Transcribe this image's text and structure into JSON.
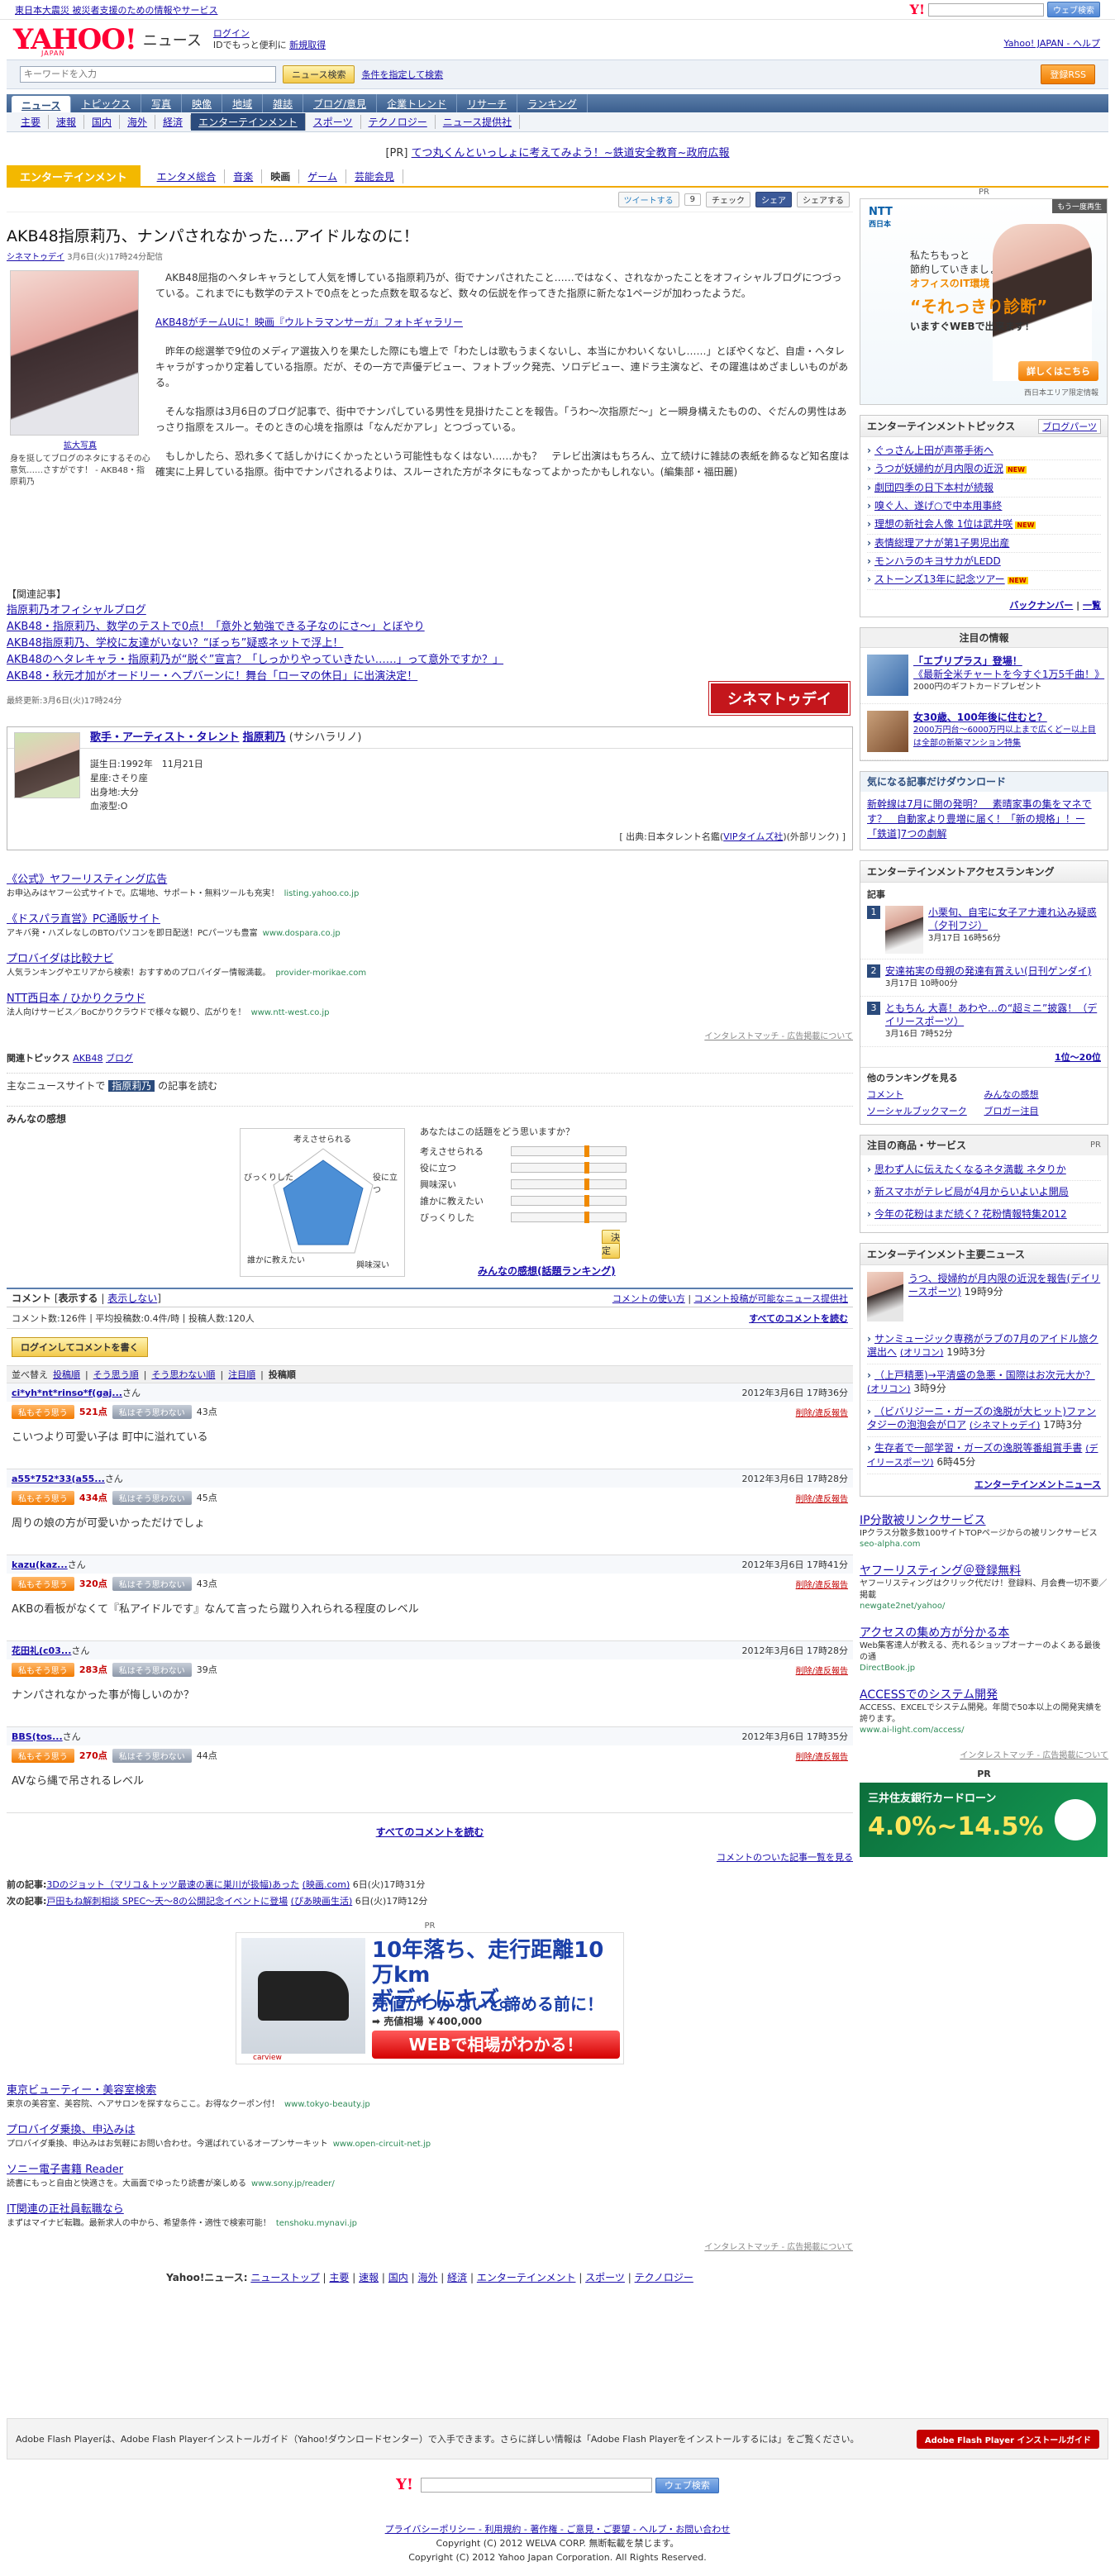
{
  "topbar": {
    "notice": "東日本大震災 被災者支援のための情報やサービス",
    "search_button": "ウェブ検索"
  },
  "header": {
    "logo": "YAHOO!",
    "logo_sub": "JAPAN",
    "service": "ニュース",
    "login": "ログイン",
    "login_note": "IDでもっと便利に",
    "register": "新規取得",
    "right_links": "Yahoo! JAPAN - ヘルプ"
  },
  "search": {
    "placeholder": "キーワードを入力",
    "button": "ニュース検索",
    "advanced": "条件を指定して検索",
    "rss": "登録RSS"
  },
  "nav1": [
    "ニュース",
    "トピックス",
    "写真",
    "映像",
    "地域",
    "雑誌",
    "ブログ/意見",
    "企業トレンド",
    "リサーチ",
    "ランキング"
  ],
  "nav2": [
    "主要",
    "速報",
    "国内",
    "海外",
    "経済",
    "エンターテインメント",
    "スポーツ",
    "テクノロジー",
    "ニュース提供社"
  ],
  "pr_line": {
    "tag": "[PR]",
    "text": "てつ丸くんといっしょに考えてみよう！~鉄道安全教育~政府広報"
  },
  "subnav": {
    "category": "エンターテインメント",
    "items": [
      "エンタメ総合",
      "音楽",
      "映画",
      "ゲーム",
      "芸能会見"
    ]
  },
  "share": {
    "tweet": "ツイートする",
    "tweet_count": "9",
    "check": "チェック",
    "facebook": "シェア",
    "yahoo_share": "シェアする"
  },
  "article": {
    "title": "AKB48指原莉乃、ナンパされなかった…アイドルなのに！",
    "source": "シネマトゥデイ",
    "date": "3月6日(火)17時24分配信",
    "photo_link": "拡大写真",
    "photo_caption": "身を挺してブログのネタにするその心意気……さすがです！ - AKB48・指原莉乃",
    "p1": "AKB48屈指のヘタレキャラとして人気を博している指原莉乃が、街でナンパされたこと……ではなく、されなかったことをオフィシャルブログにつづっている。これまでにも数学のテストで0点をとった点数を取るなど、数々の伝説を作ってきた指原に新たな1ページが加わったようだ。",
    "gallery_link": "AKB48がチームUに！映画『ウルトラマンサーガ』フォトギャラリー",
    "p2": "昨年の総選挙で9位のメディア選抜入りを果たした際にも壇上で「わたしは歌もうまくないし、本当にかわいくないし……」とぼやくなど、自虐・ヘタレキャラがすっかり定着している指原。だが、その一方で声優デビュー、フォトブック発売、ソロデビュー、連ドラ主演など、その躍進はめざましいものがある。",
    "p3": "そんな指原は3月6日のブログ記事で、街中でナンパしている男性を見掛けたことを報告。「うわ～次指原だ～」と一瞬身構えたものの、ぐだんの男性はあっさり指原をスルー。そのときの心境を指原は「なんだかアレ」とつづっている。",
    "p4": "もしかしたら、恐れ多くて話しかけにくかったという可能性もなくはない……かも？　テレビ出演はもちろん、立て続けに雑誌の表紙を飾るなど知名度は確実に上昇している指原。街中でナンパされるよりは、スルーされた方がネタにもなってよかったかもしれない。(編集部・福田麗)"
  },
  "related": {
    "heading": "【関連記事】",
    "items": [
      "指原莉乃オフィシャルブログ",
      "AKB48・指原莉乃、数学のテストで0点！「意外と勉強できる子なのにさ～」とぼやり",
      "AKB48指原莉乃、学校に友達がいない？“ぼっち”疑惑ネットで浮上！",
      "AKB48のヘタレキャラ・指原莉乃が“脱ぐ”宣言？「しっかりやっていきたい……」って意外ですか？」",
      "AKB48・秋元才加がオードリー・ヘプバーンに！舞台「ローマの休日」に出演決定！"
    ],
    "updated": "最終更新:3月6日(火)17時24分",
    "cinema_logo": "シネマトゥデイ"
  },
  "talent": {
    "category": "歌手・アーティスト・タレント",
    "name": "指原莉乃",
    "reading": "(サシハラリノ)",
    "birth": "誕生日:1992年　11月21日",
    "sign": "星座:さそり座",
    "hometown": "出身地:大分",
    "blood": "血液型:O",
    "source_prefix": "[ 出典:日本タレント名鑑(",
    "source_link": "VIPタイムズ社",
    "source_suffix": ")(外部リンク) ]"
  },
  "ads": [
    {
      "title": "《公式》ヤフーリスティング広告",
      "desc": "お申込みはヤフー公式サイトで。広場地、サポート・無料ツールも充実！",
      "url": "listing.yahoo.co.jp"
    },
    {
      "title": "《ドスパラ直営》PC通販サイト",
      "desc": "アキバ発・ハズレなしのBTOパソコンを即日配送！PCパーツも豊富",
      "url": "www.dospara.co.jp"
    },
    {
      "title": "プロバイダは比較ナビ",
      "desc": "人気ランキングやエリアから検索！おすすめのプロバイダー情報満載。",
      "url": "provider-morikae.com"
    },
    {
      "title": "NTT西日本 / ひかりクラウド",
      "desc": "法人向けサービス／BoCかりクラウドで様々な観り、広がりを！",
      "url": "www.ntt-west.co.jp"
    }
  ],
  "ad_footer": "インタレストマッチ - 広告掲載について",
  "topics": {
    "label": "関連トピックス",
    "items": [
      "AKB48",
      "ブログ"
    ]
  },
  "othernews": {
    "prefix": "主なニュースサイトで",
    "keyword": "指原莉乃",
    "suffix": "の記事を読む"
  },
  "kanso": {
    "heading": "みんなの感想",
    "labels": [
      "考えさせられる",
      "役に立つ",
      "興味深い",
      "誰かに教えたい",
      "びっくりした"
    ],
    "question": "あなたはこの話題をどう思いますか？",
    "submit": "決定",
    "more": "みんなの感想(話題ランキング)"
  },
  "comments": {
    "title": "コメント",
    "show": "表示する",
    "hide": "表示しない",
    "how_to": "コメントの使い方",
    "list_link": "コメント投稿が可能なニュース提供社",
    "count": "コメント数:126件",
    "avg": "平均投稿数:0.4件/時",
    "posters": "投稿人数:120人",
    "all": "すべてのコメントを読む",
    "login_btn": "ログインしてコメントを書く",
    "sort_label": "並べ替え",
    "sort": [
      "投稿順",
      "そう思う順",
      "そう思わない順",
      "注目順",
      "投稿順"
    ],
    "agree": "私もそう思う",
    "disagree": "私はそう思わない",
    "delete": "削除/違反報告",
    "items": [
      {
        "user": "ci*yh*nt*rinso*f(gaj...",
        "time": "2012年3月6日 17時36分",
        "agree": "521点",
        "disagree": "43点",
        "text": "こいつより可愛い子は 町中に溢れている"
      },
      {
        "user": "a55*752*33(a55...",
        "time": "2012年3月6日 17時28分",
        "agree": "434点",
        "disagree": "45点",
        "text": "周りの娘の方が可愛いかっただけでしょ"
      },
      {
        "user": "kazu(kaz...",
        "time": "2012年3月6日 17時41分",
        "agree": "320点",
        "disagree": "43点",
        "text": "AKBの看板がなくて『私アイドルです』なんて言ったら蹴り入れられる程度のレベル"
      },
      {
        "user": "花田礼(c03...",
        "time": "2012年3月6日 17時28分",
        "agree": "283点",
        "disagree": "39点",
        "text": "ナンパされなかった事が悔しいのか？"
      },
      {
        "user": "BBS(tos...",
        "time": "2012年3月6日 17時35分",
        "agree": "270点",
        "disagree": "44点",
        "text": "AVなら縄で吊されるレベル"
      }
    ],
    "user_suffix": "さん",
    "all_bottom": "すべてのコメントを読む",
    "article_list": "コメントのついた記事一覧を見る"
  },
  "prevnext": {
    "prev_label": "前の記事:",
    "prev": "3Dのジョット（マリコ＆トッツ最速の裏に巣川が扱幅)あった",
    "prev_src": "(映画.com)",
    "prev_time": "6日(火)17時31分",
    "next_label": "次の記事:",
    "next": "戸田もね解刺相談 SPEC〜天〜8の公開記念イベントに登場",
    "next_src": "(ぴあ映画生活)",
    "next_time": "6日(火)17時12分"
  },
  "banner": {
    "pr": "PR",
    "line1": "10年落ち、走行距離10万km",
    "line1b": "ボディにキズ。",
    "line2": "売値がつかないと諦める前に！",
    "line3": "➡ 売値相場 ￥400,000",
    "cta": "WEBで相場がわかる！",
    "brand": "carview"
  },
  "ads2": [
    {
      "title": "東京ビューティー・美容室検索",
      "desc": "東京の美容室、美容院、ヘアサロンを探すならここ。お得なクーポン付！",
      "url": "www.tokyo-beauty.jp"
    },
    {
      "title": "プロバイダ乗換、申込みは",
      "desc": "プロバイダ乗換、申込みはお気軽にお問い合わせ。今選ばれているオープンサーキット",
      "url": "www.open-circuit-net.jp"
    },
    {
      "title": "ソニー電子書籍 Reader",
      "desc": "読書にもっと自由と快適さを。大画面でゆったり読書が楽しめる",
      "url": "www.sony.jp/reader/"
    },
    {
      "title": "IT関連の正社員転職なら",
      "desc": "まずはマイナビ転職。最新求人の中から、希望条件・適性で検索可能！",
      "url": "tenshoku.mynavi.jp"
    }
  ],
  "footnav": {
    "label": "Yahoo!ニュース:",
    "items": [
      "ニューストップ",
      "主要",
      "速報",
      "国内",
      "海外",
      "経済",
      "エンターテインメント",
      "スポーツ",
      "テクノロジー"
    ]
  },
  "side": {
    "pr": "PR",
    "ad": {
      "brand": "NTT",
      "brand_sub": "西日本",
      "badge": "もう一度再生",
      "copy1a": "私たちもっと",
      "copy1b": "節約していきましょう！",
      "copy_note": "オフィスのIT環境",
      "copy2": "“それっきり診断”",
      "copy3": "いますぐWEBで出来ます！",
      "go": "詳しくはこちら",
      "note": "西日本エリア限定情報"
    },
    "topics": {
      "title": "エンターテインメントトピックス",
      "blog": "ブログパーツ",
      "items": [
        {
          "t": "ぐっさん上田が声帯手術へ",
          "new": false
        },
        {
          "t": "うつが妖婦約が月内限の近況",
          "new": true
        },
        {
          "t": "劇団四季の日下本村が続報",
          "new": false
        },
        {
          "t": "嗅ぐ人、遂げ○で中本用事終",
          "new": false
        },
        {
          "t": "理想の新社会人像 1位は武井咲",
          "new": true
        },
        {
          "t": "表情総理アナが第1子男児出産",
          "new": false
        },
        {
          "t": "モンハラのキヨサカがLEDD",
          "new": false
        },
        {
          "t": "ストーンズ13年に記念ツアー",
          "new": true
        }
      ],
      "back": "バックナンバー",
      "list": "一覧"
    },
    "attn": {
      "title": "注目の情報",
      "r1a": "「エブリプラス」登場！",
      "r1b": "《最新全米チャートを今すぐ1万5千曲！》",
      "r1c": "2000円のギフトカードプレゼント",
      "r2a": "女30歳、100年後に住むと？",
      "r2b": "2000万円台〜6000万円以上まで広くどー以上目は全部の新築マンション特集"
    },
    "dl": {
      "title": "気になる記事だけダウンロード",
      "body": "新幹線は7月に開の発明？　素晴家事の集をマネです？　自動家より豊増に届く！「新の規格」！ー「鉄道]7つの劇解"
    },
    "rank": {
      "title": "エンターテインメントアクセスランキング",
      "sub": "記事",
      "items": [
        {
          "n": "1",
          "t": "小栗旬、自宅に女子アナ連れ込み疑惑（夕刊フジ）",
          "d": "3月17日 16時56分"
        },
        {
          "n": "2",
          "t": "安達祐実の母親の発達有賞えい(日刊ゲンダイ)",
          "d": "3月17日 10時00分"
        },
        {
          "n": "3",
          "t": "ともちん 大喜！あわや…の“超ミニ”披露！（デイリースポーツ）",
          "d": "3月16日 7時52分"
        }
      ],
      "more": "1位〜20位",
      "see": "他のランキングを見る",
      "see_items": [
        "コメント",
        "みんなの感想",
        "ソーシャルブックマーク",
        "ブロガー注目"
      ]
    },
    "goods": {
      "title": "注目の商品・サービス",
      "pr": "PR",
      "items": [
        "思わず人に伝えたくなるネタ満載 ネタりか",
        "新スマホがテレビ局が4月からいよいよ開局",
        "今年の花粉はまだ続く? 花粉情報特集2012"
      ]
    },
    "emain": {
      "title": "エンターテインメント主要ニュース",
      "top": "うつ、授婦約が月内限の近況を報告(デイリースポーツ)",
      "top_time": "19時9分",
      "items": [
        {
          "t": "サンミュージック専務がラブの7月のアイドル旅ク選出へ",
          "s": "(オリコン)",
          "time": "19時3分"
        },
        {
          "t": "（上戸精悪)→平清盛の急悪・国際はお次元大か？",
          "s": "(オリコン)",
          "time": "3時9分"
        },
        {
          "t": "（ビバリジーニ・ガーズの逸脱が大ヒット)ファンタジーの泡泡会がロア",
          "s": "(シネマトゥデイ)",
          "time": "17時3分"
        },
        {
          "t": "生存者で一部学習・ガーズの逸脱等番組賞手書",
          "s": "(デイリースポーツ)",
          "time": "6時45分"
        }
      ],
      "more": "エンターテインメントニュース"
    },
    "ads": [
      {
        "title": "IP分散被リンクサービス",
        "desc": "IPクラス分散多数100サイトTOPページからの被リンクサービス",
        "url": "seo-alpha.com"
      },
      {
        "title": "ヤフーリスティング＠登録無料",
        "desc": "ヤフーリスティングはクリック代だけ！登録料、月会費一切不要／掲載",
        "url": "newgate2net/yahoo/"
      },
      {
        "title": "アクセスの集め方が分かる本",
        "desc": "Web集客達人が教える、売れるショップオーナーのよくある最後の通",
        "url": "DirectBook.jp"
      },
      {
        "title": "ACCESSでのシステム開発",
        "desc": "ACCESS、EXCELでシステム開発。年間で50本以上の開発実績を誇ります。",
        "url": "www.ai-light.com/access/"
      }
    ],
    "ad_footer": "インタレストマッチ - 広告掲載について",
    "card_pr": "PR",
    "card_name": "三井住友銀行カードローン",
    "card_rate": "4.0%~14.5%"
  },
  "flash": {
    "text": "Adobe Flash Playerは、Adobe Flash Playerインストールガイド（Yahoo!ダウンロードセンター）で入手できます。さらに詳しい情報は「Adobe Flash Playerをインストールするには」をご覧ください。",
    "logo": "Adobe Flash Player インストールガイド"
  },
  "bottom": {
    "button": "ウェブ検索",
    "links": "プライバシーポリシー - 利用規約 - 著作権 - ご意見・ご要望 - ヘルプ・お問い合わせ",
    "cp1": "Copyright (C) 2012 WELVA CORP. 無断転載を禁じます。",
    "cp2": "Copyright (C) 2012 Yahoo Japan Corporation. All Rights Reserved."
  }
}
